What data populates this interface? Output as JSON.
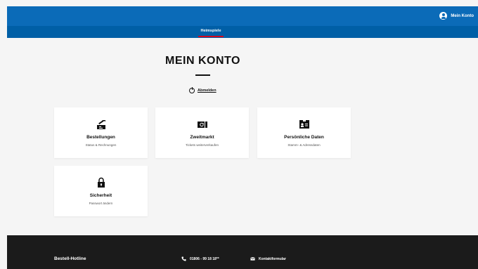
{
  "header": {
    "account_label": "Mein Konto",
    "brand_color": "#0b6bb8"
  },
  "subnav": {
    "tab_label": "Heimspiele",
    "accent_color": "#d6001c"
  },
  "main": {
    "title": "MEIN KONTO",
    "logout_label": "Abmelden",
    "logout_icon": "power-icon",
    "cards": [
      {
        "label": "Bestellungen",
        "sub": "Status & Rechnungen",
        "icon": "orders-icon"
      },
      {
        "label": "Zweitmarkt",
        "sub": "Tickets weiterverkaufen",
        "icon": "ticket-icon"
      },
      {
        "label": "Persönliche Daten",
        "sub": "Stamm- & Adressdaten",
        "icon": "id-card-icon"
      },
      {
        "label": "Sicherheit",
        "sub": "Passwort ändern",
        "icon": "lock-icon"
      }
    ]
  },
  "footer": {
    "hotline_label": "Bestell-Hotline",
    "phone_number": "01806 - 99 18 18**",
    "phone_icon": "phone-icon",
    "contact_label": "Kontaktformular",
    "contact_icon": "mail-icon"
  }
}
